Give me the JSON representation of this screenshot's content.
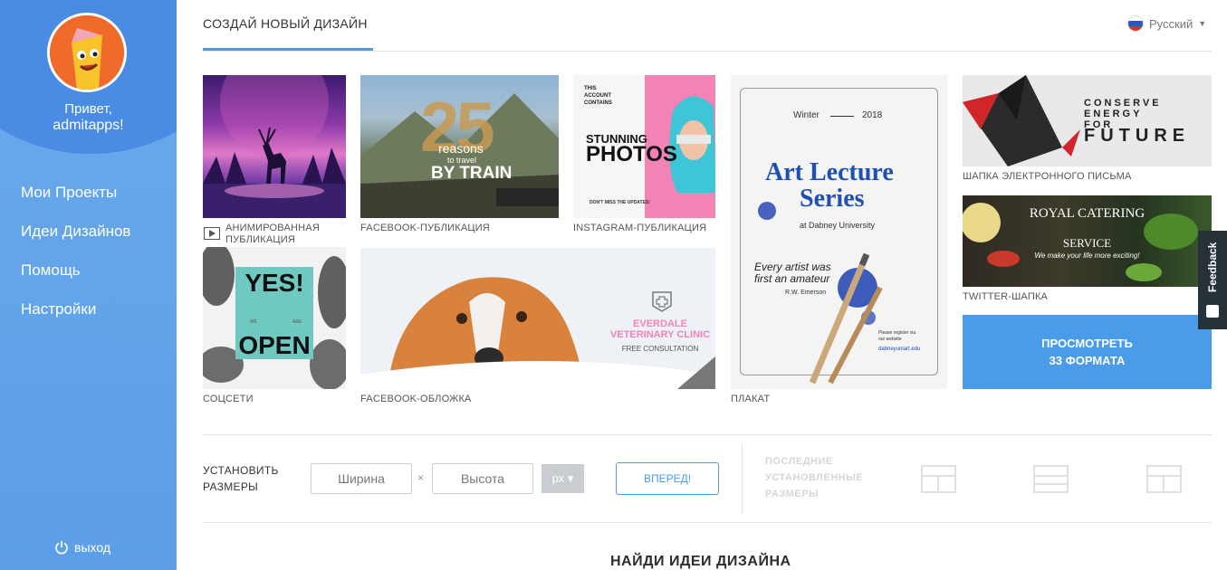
{
  "sidebar": {
    "greeting": "Привет,",
    "username": "admitapps!",
    "items": [
      {
        "label": "Мои Проекты"
      },
      {
        "label": "Идеи Дизайнов"
      },
      {
        "label": "Помощь"
      },
      {
        "label": "Настройки"
      }
    ],
    "logout_label": "выход"
  },
  "header": {
    "tab_title": "СОЗДАЙ НОВЫЙ ДИЗАЙН",
    "language": "Русский"
  },
  "cards": {
    "animated": {
      "caption_line1": "АНИМИРОВАННАЯ",
      "caption_line2": "ПУБЛИКАЦИЯ"
    },
    "facebook_post": {
      "caption": "FACEBOOK-ПУБЛИКАЦИЯ",
      "num": "25",
      "word1": "reasons",
      "word2": "to travel",
      "word3": "BY TRAIN"
    },
    "instagram_post": {
      "caption": "INSTAGRAM-ПУБЛИКАЦИЯ",
      "small1": "THIS",
      "small2": "ACCOUNT",
      "small3": "CONTAINS",
      "big1": "STUNNING",
      "big2": "PHOTOS",
      "footer": "DON'T MISS THE UPDATES!"
    },
    "poster": {
      "caption": "ПЛАКАТ",
      "season": "Winter",
      "year": "2018",
      "title1": "Art Lecture",
      "title2": "Series",
      "sub": "at Dabney University",
      "quote1": "Every artist was",
      "quote2": "first an amateur",
      "author": "R.W. Emerson",
      "reg1": "Please register via",
      "reg2": "our website",
      "site": "dabneyuniart.edu"
    },
    "email_header": {
      "caption": "ШАПКА ЭЛЕКТРОННОГО ПИСЬМА",
      "l1": "CONSERVE",
      "l2": "ENERGY",
      "l3": "FOR",
      "l4": "FUTURE"
    },
    "twitter_header": {
      "caption": "TWITTER-ШАПКА",
      "t1": "ROYAL CATERING",
      "t2": "SERVICE",
      "t3": "We make your life more exciting!"
    },
    "social": {
      "caption": "СОЦСЕТИ",
      "w1": "YES!",
      "s1": "WE",
      "s2": "ARE",
      "w2": "OPEN"
    },
    "facebook_cover": {
      "caption": "FACEBOOK-ОБЛОЖКА",
      "t1": "EVERDALE",
      "t2": "VETERINARY CLINIC",
      "t3": "FREE CONSULTATION"
    }
  },
  "more_button": {
    "line1": "ПРОСМОТРЕТЬ",
    "line2": "33 ФОРМАТА"
  },
  "feedback": {
    "label": "Feedback"
  },
  "sizes": {
    "label_line1": "УСТАНОВИТЬ",
    "label_line2": "РАЗМЕРЫ",
    "width_placeholder": "Ширина",
    "height_placeholder": "Высота",
    "times": "×",
    "unit": "px ▾",
    "go_label": "ВПЕРЕД!",
    "last_line1": "ПОСЛЕДНИЕ",
    "last_line2": "УСТАНОВЛЕННЫЕ",
    "last_line3": "РАЗМЕРЫ"
  },
  "find_heading": "НАЙДИ ИДЕИ ДИЗАЙНА",
  "colors": {
    "accent": "#4a9be8",
    "sidebar": "#5c9fe8",
    "pink": "#f184b4"
  }
}
